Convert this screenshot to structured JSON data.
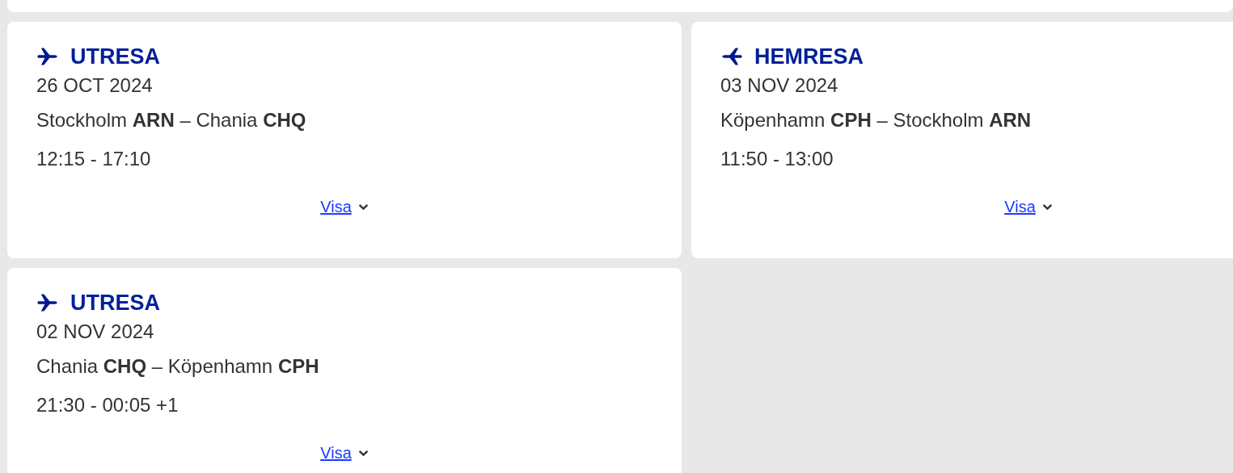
{
  "flights": [
    {
      "kind": "outbound",
      "title": "UTRESA",
      "date": "26 OCT 2024",
      "route": "Stockholm **ARN** – Chania **CHQ**",
      "time": "12:15 - 17:10",
      "link": "Visa"
    },
    {
      "kind": "return",
      "title": "HEMRESA",
      "date": "03 NOV 2024",
      "route": "Köpenhamn **CPH** – Stockholm **ARN**",
      "time": "11:50 - 13:00",
      "link": "Visa"
    },
    {
      "kind": "outbound",
      "title": "UTRESA",
      "date": "02 NOV 2024",
      "route": "Chania **CHQ** – Köpenhamn **CPH**",
      "time": "21:30 - 00:05 +1",
      "link": "Visa"
    }
  ]
}
